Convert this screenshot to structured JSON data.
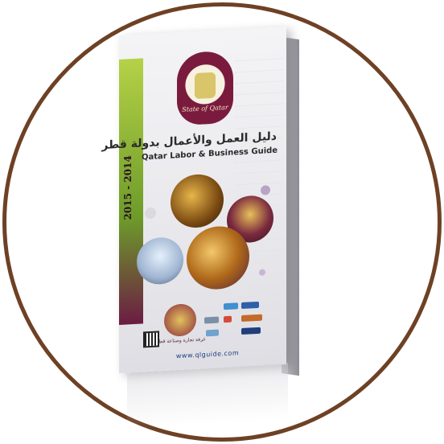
{
  "book": {
    "year_range": "2015 - 2014",
    "emblem_text": "State of Qatar",
    "title_ar": "دليل العمل والأعمال بدولة قطر",
    "title_en": "Qatar Labor & Business Guide",
    "website": "www.qlguide.com",
    "sponsor_text": "غرفة تجارة وصناعة قطر"
  },
  "icons": {
    "emblem": "qatar-emblem-icon",
    "qr": "qr-code-icon",
    "sponsor": "chamber-logo-icon"
  },
  "colors": {
    "frame": "#6e4125",
    "maroon": "#7a1b3e",
    "accent_green": "#8fb53a",
    "link_blue": "#1b3b7a"
  }
}
